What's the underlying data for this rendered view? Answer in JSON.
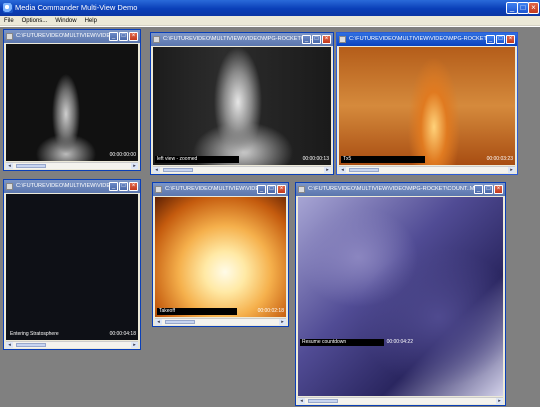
{
  "app": {
    "title": "Media Commander Multi-View Demo"
  },
  "menu": [
    "File",
    "Options...",
    "Window",
    "Help"
  ],
  "windows": [
    {
      "title": "C:\\FUTUREVIDEO\\MULTIVIEW\\VIDE...",
      "caption": "",
      "timecode": "00:00:00:00"
    },
    {
      "title": "C:\\FUTUREVIDEO\\MULTIVIEW\\VIDEO\\MPG-ROCKET\\LA...",
      "caption": "left view - zoomed",
      "timecode": "00:00:00:13"
    },
    {
      "title": "C:\\FUTUREVIDEO\\MULTIVIEW\\VIDEO\\MPG-ROCKET\\C...",
      "caption": "Tx5",
      "timecode": "00:00:03:23"
    },
    {
      "title": "C:\\FUTUREVIDEO\\MULTIVIEW\\VIDE...",
      "caption": "Entering Stratosphere",
      "timecode": "00:00:04:18"
    },
    {
      "title": "C:\\FUTUREVIDEO\\MULTIVIEW\\VIDE...",
      "caption": "Takeoff",
      "timecode": "00:00:02:18"
    },
    {
      "title": "C:\\FUTUREVIDEO\\MULTIVIEW\\VIDEO\\MPG-ROCKET\\COUNT..MPG",
      "caption": "Resume countdown",
      "timecode": "00:00:04:22"
    }
  ],
  "icons": {
    "minimize": "minimize-icon",
    "maximize": "maximize-icon",
    "close": "close-icon"
  }
}
